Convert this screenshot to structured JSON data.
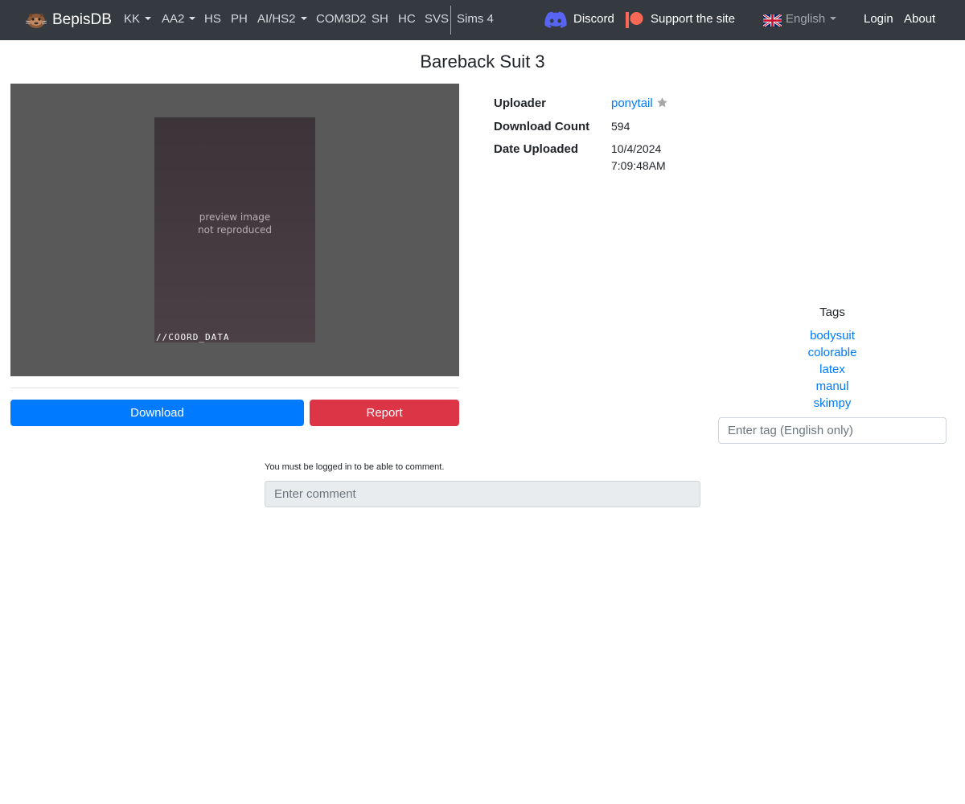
{
  "navbar": {
    "brand": "BepisDB",
    "items": [
      {
        "label": "KK",
        "dropdown": true
      },
      {
        "label": "AA2",
        "dropdown": true
      },
      {
        "label": "HS",
        "dropdown": false
      },
      {
        "label": "PH",
        "dropdown": false
      },
      {
        "label": "AI/HS2",
        "dropdown": true
      },
      {
        "label": "COM3D2",
        "dropdown": false
      },
      {
        "label": "SH",
        "dropdown": false
      },
      {
        "label": "HC",
        "dropdown": false
      },
      {
        "label": "SVS",
        "dropdown": false
      },
      {
        "label": "Sims 4",
        "dropdown": false
      }
    ],
    "discord": "Discord",
    "support": "Support the site",
    "language": "English",
    "login": "Login",
    "about": "About",
    "icons": {
      "discord": "discord-icon",
      "support": "patreon-icon",
      "language": "uk-flag-icon"
    }
  },
  "page": {
    "title": "Bareback Suit 3",
    "preview": {
      "caption": "//COORD_DATA"
    },
    "download_label": "Download",
    "report_label": "Report"
  },
  "info": {
    "uploader_label": "Uploader",
    "uploader": "ponytail",
    "download_count_label": "Download Count",
    "download_count": "594",
    "date_label": "Date Uploaded",
    "date": "10/4/2024",
    "time": "7:09:48AM"
  },
  "tags": {
    "title": "Tags",
    "items": [
      "bodysuit",
      "colorable",
      "latex",
      "manul",
      "skimpy"
    ],
    "input_placeholder": "Enter tag (English only)"
  },
  "comments": {
    "note": "You must be logged in to be able to comment.",
    "input_placeholder": "Enter comment"
  },
  "colors": {
    "navbar_bg": "#343a40",
    "primary": "#007bff",
    "danger": "#dc3545",
    "preview_bg": "#595959"
  }
}
